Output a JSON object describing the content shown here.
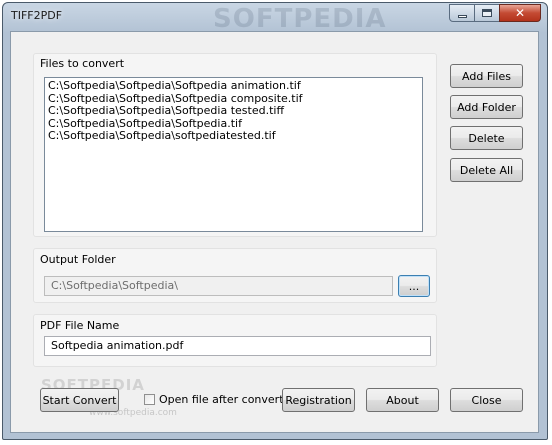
{
  "window": {
    "title": "TIFF2PDF",
    "watermark": "SOFTPEDIA",
    "controls": {
      "minimize_icon": "minimize-icon",
      "maximize_icon": "maximize-icon",
      "close_icon": "close-icon",
      "close_glyph": "✕"
    }
  },
  "files_group": {
    "label": "Files to convert",
    "files": [
      "C:\\Softpedia\\Softpedia\\Softpedia animation.tif",
      "C:\\Softpedia\\Softpedia\\Softpedia composite.tif",
      "C:\\Softpedia\\Softpedia\\Softpedia tested.tiff",
      "C:\\Softpedia\\Softpedia\\Softpedia.tif",
      "C:\\Softpedia\\Softpedia\\softpediatested.tif"
    ]
  },
  "side_buttons": {
    "add_files": "Add Files",
    "add_folder": "Add Folder",
    "delete": "Delete",
    "delete_all": "Delete All"
  },
  "output_group": {
    "label": "Output Folder",
    "path": "C:\\Softpedia\\Softpedia\\",
    "browse_label": "..."
  },
  "pdf_group": {
    "label": "PDF File Name",
    "value": "Softpedia animation.pdf"
  },
  "bottom_bar": {
    "start_convert": "Start Convert",
    "open_after_convert": "Open file after convert",
    "open_after_convert_checked": false,
    "registration": "Registration",
    "about": "About",
    "close": "Close"
  },
  "overlay_watermark": {
    "logo": "SOFTPEDIA",
    "url": "www.softpedia.com"
  },
  "colors": {
    "title_bar": "#b2c2d4",
    "client_bg": "#f0f0f0",
    "close_button": "#c44a33"
  }
}
